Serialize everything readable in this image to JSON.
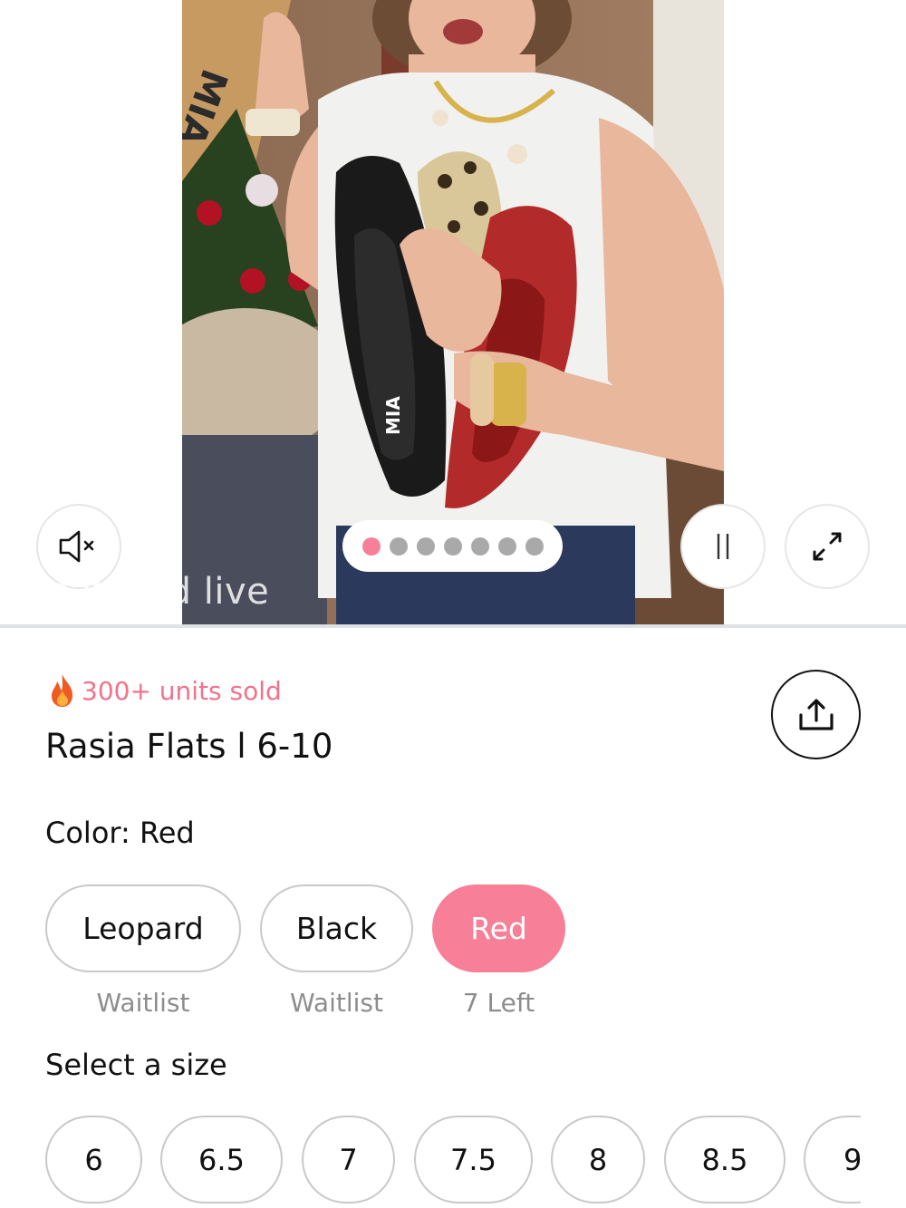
{
  "media": {
    "featured_label": "Featured live",
    "carousel": {
      "count": 7,
      "active_index": 0
    },
    "video_overlay_text": "MIA",
    "controls": {
      "mute_icon": "speaker-muted-icon",
      "pause_icon": "pause-icon",
      "expand_icon": "expand-icon"
    }
  },
  "product": {
    "sold_badge": "300+ units sold",
    "title": "Rasia Flats l 6-10",
    "share_icon": "share-icon",
    "color_label": "Color: Red",
    "colors": [
      {
        "label": "Leopard",
        "status": "Waitlist",
        "selected": false
      },
      {
        "label": "Black",
        "status": "Waitlist",
        "selected": false
      },
      {
        "label": "Red",
        "status": "7 Left",
        "selected": true
      }
    ],
    "size_label": "Select a size",
    "sizes": [
      "6",
      "6.5",
      "7",
      "7.5",
      "8",
      "8.5",
      "9"
    ]
  },
  "theme": {
    "accent": "#f77f97",
    "accent_text": "#f2728c",
    "muted_text": "#8d8d8d",
    "border": "#c9c9c9"
  }
}
